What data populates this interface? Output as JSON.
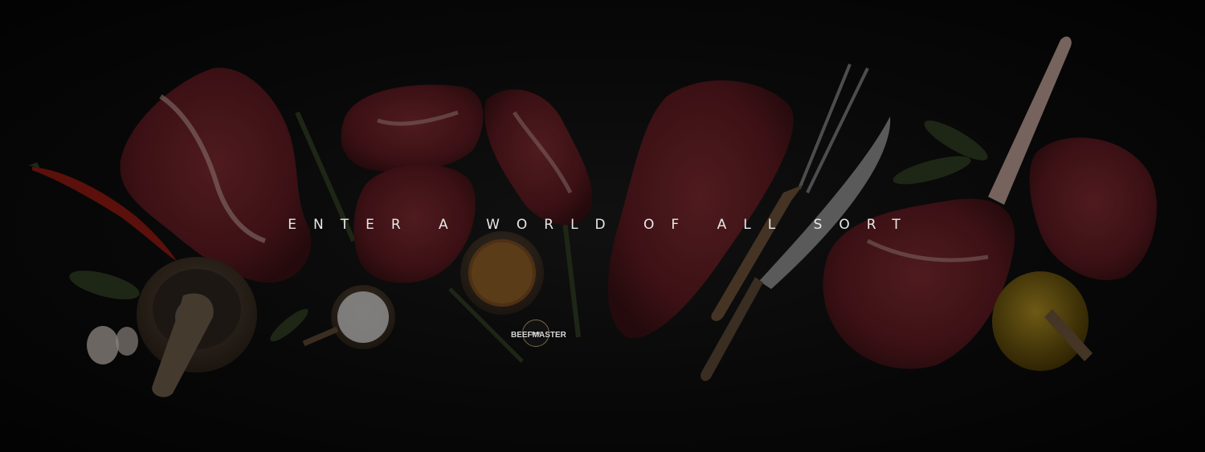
{
  "hero": {
    "headline": "ENTER A WORLD OF ALL SORT",
    "background_icon": "meat-spread-background",
    "overlay_color": "#000000"
  },
  "logo": {
    "brand": "BEEFMASTER",
    "icon": "bull-icon",
    "accent_color": "#7a6a4a"
  },
  "colors": {
    "meat": "#6e1f25",
    "meat_dark": "#4a1418",
    "fat": "#c9a9a3",
    "chili": "#9a1a12",
    "herb": "#2f3d22",
    "wood": "#5a4634",
    "oil": "#8a6a10"
  }
}
